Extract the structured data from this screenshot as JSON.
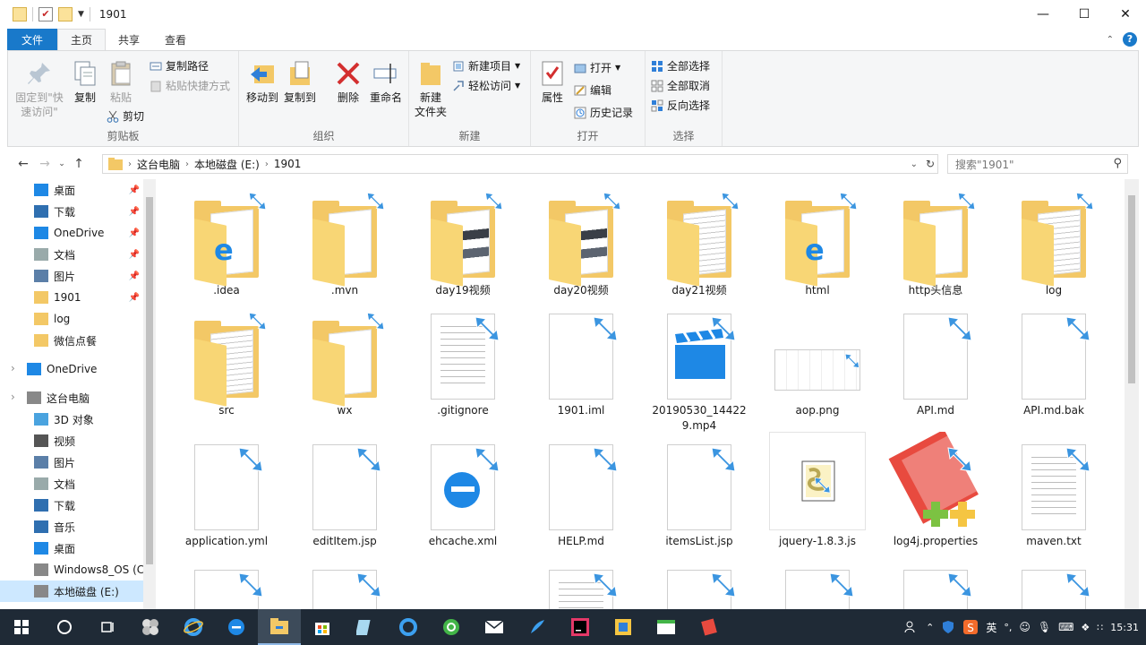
{
  "window": {
    "title": "1901"
  },
  "ribbon_tabs": [
    "文件",
    "主页",
    "共享",
    "查看"
  ],
  "ribbon": {
    "clipboard": {
      "label": "剪贴板",
      "pin": "固定到\"快速访问\"",
      "copy": "复制",
      "paste": "粘贴",
      "copy_path": "复制路径",
      "paste_shortcut": "粘贴快捷方式",
      "cut": "剪切"
    },
    "organize": {
      "label": "组织",
      "move_to": "移动到",
      "copy_to": "复制到",
      "delete": "删除",
      "rename": "重命名"
    },
    "new": {
      "label": "新建",
      "new_folder": "新建\n文件夹",
      "new_item": "新建项目",
      "easy_access": "轻松访问"
    },
    "open": {
      "label": "打开",
      "properties": "属性",
      "open": "打开",
      "edit": "编辑",
      "history": "历史记录"
    },
    "select": {
      "label": "选择",
      "select_all": "全部选择",
      "select_none": "全部取消",
      "invert": "反向选择"
    }
  },
  "address": {
    "segments": [
      "这台电脑",
      "本地磁盘 (E:)",
      "1901"
    ],
    "search_placeholder": "搜索\"1901\""
  },
  "nav": {
    "quick": [
      "桌面",
      "下载",
      "OneDrive",
      "文档",
      "图片",
      "1901",
      "log",
      "微信点餐"
    ],
    "onedrive": "OneDrive",
    "thispc": "这台电脑",
    "pc_items": [
      "3D 对象",
      "视频",
      "图片",
      "文档",
      "下载",
      "音乐",
      "桌面",
      "Windows8_OS (C",
      "本地磁盘 (E:)"
    ]
  },
  "files": [
    {
      "name": ".idea",
      "kind": "folder-e"
    },
    {
      "name": ".mvn",
      "kind": "folder"
    },
    {
      "name": "day19视频",
      "kind": "folder-img"
    },
    {
      "name": "day20视频",
      "kind": "folder-img"
    },
    {
      "name": "day21视频",
      "kind": "folder-doc"
    },
    {
      "name": "html",
      "kind": "folder-e"
    },
    {
      "name": "http头信息",
      "kind": "folder"
    },
    {
      "name": "log",
      "kind": "folder-doc"
    },
    {
      "name": "src",
      "kind": "folder-doc"
    },
    {
      "name": "wx",
      "kind": "folder"
    },
    {
      "name": ".gitignore",
      "kind": "doc-lines"
    },
    {
      "name": "1901.iml",
      "kind": "doc"
    },
    {
      "name": "20190530_144229.mp4",
      "kind": "video"
    },
    {
      "name": "aop.png",
      "kind": "image"
    },
    {
      "name": "API.md",
      "kind": "doc"
    },
    {
      "name": "API.md.bak",
      "kind": "doc"
    },
    {
      "name": "application.yml",
      "kind": "doc"
    },
    {
      "name": "editItem.jsp",
      "kind": "doc"
    },
    {
      "name": "ehcache.xml",
      "kind": "edge"
    },
    {
      "name": "HELP.md",
      "kind": "doc"
    },
    {
      "name": "itemsList.jsp",
      "kind": "doc"
    },
    {
      "name": "jquery-1.8.3.js",
      "kind": "script"
    },
    {
      "name": "log4j.properties",
      "kind": "notepad"
    },
    {
      "name": "maven.txt",
      "kind": "doc-lines"
    },
    {
      "name": "",
      "kind": "doc"
    },
    {
      "name": "",
      "kind": "doc"
    },
    {
      "name": "",
      "kind": "gear"
    },
    {
      "name": "",
      "kind": "doc-lines"
    },
    {
      "name": "",
      "kind": "doc"
    },
    {
      "name": "",
      "kind": "doc"
    },
    {
      "name": "",
      "kind": "doc"
    },
    {
      "name": "",
      "kind": "doc"
    }
  ],
  "tray": {
    "ime": "英",
    "time": "15:31"
  }
}
